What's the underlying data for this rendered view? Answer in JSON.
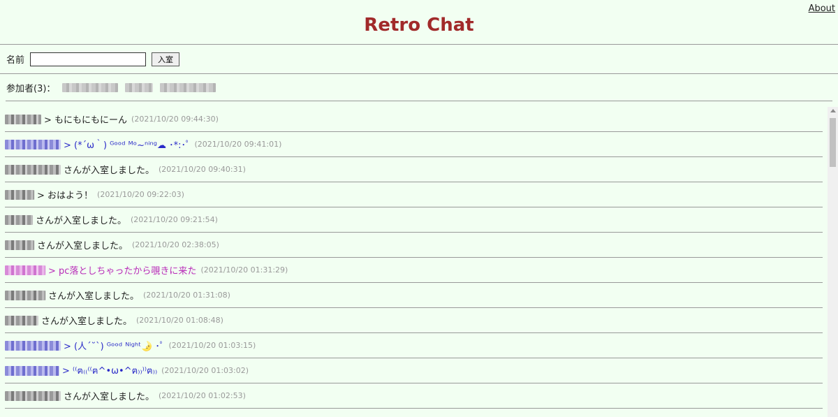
{
  "header": {
    "title": "Retro Chat",
    "about_label": "About"
  },
  "entry": {
    "name_label": "名前",
    "name_value": "",
    "enter_button_label": "入室"
  },
  "participants": {
    "label": "参加者(3)：",
    "count": 3
  },
  "messages": [
    {
      "name_style": "gray",
      "text": "> もにもにもにーん",
      "color": "default",
      "time": "(2021/10/20 09:44:30)"
    },
    {
      "name_style": "blue",
      "text": "> (*´ω｀) ᴳᵒᵒᵈ ᴹᵒ~ⁿⁱⁿᵍ☁ ･*:･ﾟ",
      "color": "blue",
      "time": "(2021/10/20 09:41:01)"
    },
    {
      "name_style": "gray",
      "text": "さんが入室しました。",
      "color": "default",
      "time": "(2021/10/20 09:40:31)"
    },
    {
      "name_style": "gray",
      "text": "> おはよう！",
      "color": "default",
      "time": "(2021/10/20 09:22:03)"
    },
    {
      "name_style": "gray",
      "text": "さんが入室しました。",
      "color": "default",
      "time": "(2021/10/20 09:21:54)"
    },
    {
      "name_style": "gray",
      "text": "さんが入室しました。",
      "color": "default",
      "time": "(2021/10/20 02:38:05)"
    },
    {
      "name_style": "pink",
      "text": "> pc落としちゃったから覗きに来た",
      "color": "pink",
      "time": "(2021/10/20 01:31:29)"
    },
    {
      "name_style": "gray",
      "text": "さんが入室しました。",
      "color": "default",
      "time": "(2021/10/20 01:31:08)"
    },
    {
      "name_style": "gray",
      "text": "さんが入室しました。",
      "color": "default",
      "time": "(2021/10/20 01:08:48)"
    },
    {
      "name_style": "blue",
      "text": "> (人´˘`) ᴳᵒᵒᵈ ᴺⁱᵍʰᵗ🌛 ･ﾟ",
      "color": "blue",
      "time": "(2021/10/20 01:03:15)"
    },
    {
      "name_style": "blue",
      "text": "> ⁽⁽ฅ₍₍⁽⁽ฅ^•ω•^ฅ₎₎⁾⁾ฅ₎₎",
      "color": "blue",
      "time": "(2021/10/20 01:03:02)"
    },
    {
      "name_style": "gray",
      "text": "さんが入室しました。",
      "color": "default",
      "time": "(2021/10/20 01:02:53)"
    }
  ],
  "colors": {
    "background": "#f2fff2",
    "title": "#a12a2a",
    "blue_message": "#2a2ac8",
    "pink_message": "#b82bb8",
    "timestamp": "#999999"
  }
}
